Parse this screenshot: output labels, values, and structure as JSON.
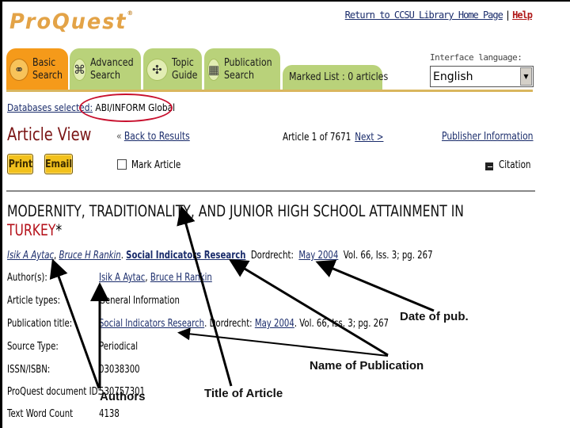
{
  "header": {
    "logo": "ProQuest",
    "logo_mark": "®",
    "return_link": "Return to CCSU Library Home Page",
    "separator": "|",
    "help_link": "Help"
  },
  "tabs": [
    {
      "label_line1": "Basic",
      "label_line2": "Search",
      "icon": "glasses-icon",
      "active": true
    },
    {
      "label_line1": "Advanced",
      "label_line2": "Search",
      "icon": "knot-icon",
      "active": false
    },
    {
      "label_line1": "Topic",
      "label_line2": "Guide",
      "icon": "compass-icon",
      "active": false
    },
    {
      "label_line1": "Publication",
      "label_line2": "Search",
      "icon": "box-icon",
      "active": false
    }
  ],
  "marked_list": "Marked List : 0 articles",
  "language": {
    "label": "Interface language:",
    "selected": "English"
  },
  "databases": {
    "label": "Databases selected:",
    "value": "ABI/INFORM Global"
  },
  "article_view": {
    "title": "Article View",
    "back_chevron": "«",
    "back_link": "Back to Results",
    "count_text": "Article 1 of 7671",
    "next_link": "Next >",
    "publisher_link": "Publisher Information",
    "print_button": "Print",
    "email_button": "Email",
    "mark_article": "Mark Article",
    "citation": "Citation"
  },
  "article": {
    "title_line1": "MODERNITY, TRADITIONALITY, AND JUNIOR HIGH SCHOOL ATTAINMENT IN",
    "title_line2": "TURKEY",
    "title_asterisk": "*",
    "author1": "Isik A Aytac",
    "author2": "Bruce H Rankin",
    "journal": "Social Indicators Research",
    "place": "Dordrecht:",
    "date": "May 2004",
    "volume_info": "Vol. 66, Iss. 3;  pg. 267"
  },
  "details": {
    "authors_label": "Author(s):",
    "author1": "Isik A Aytac",
    "author2": "Bruce H Rankin",
    "article_types_label": "Article types:",
    "article_types": "General Information",
    "pub_title_label": "Publication title:",
    "pub_title": "Social Indicators Research",
    "pub_place": ". Dordrecht:",
    "pub_date": "May 2004",
    "pub_rest": ". Vol. 66, Iss. 3;  pg. 267",
    "source_type_label": "Source Type:",
    "source_type": "Periodical",
    "issn_label": "ISSN/ISBN:",
    "issn": "03038300",
    "docid_label": "ProQuest document ID:",
    "docid": "530757301",
    "wordcount_label": "Text Word Count",
    "wordcount": "4138"
  },
  "annotations": {
    "date_of_pub": "Date of pub.",
    "name_of_publication": "Name of Publication",
    "authors": "Authors",
    "title_of_article": "Title of Article",
    "oval_color": "#c8102e"
  }
}
